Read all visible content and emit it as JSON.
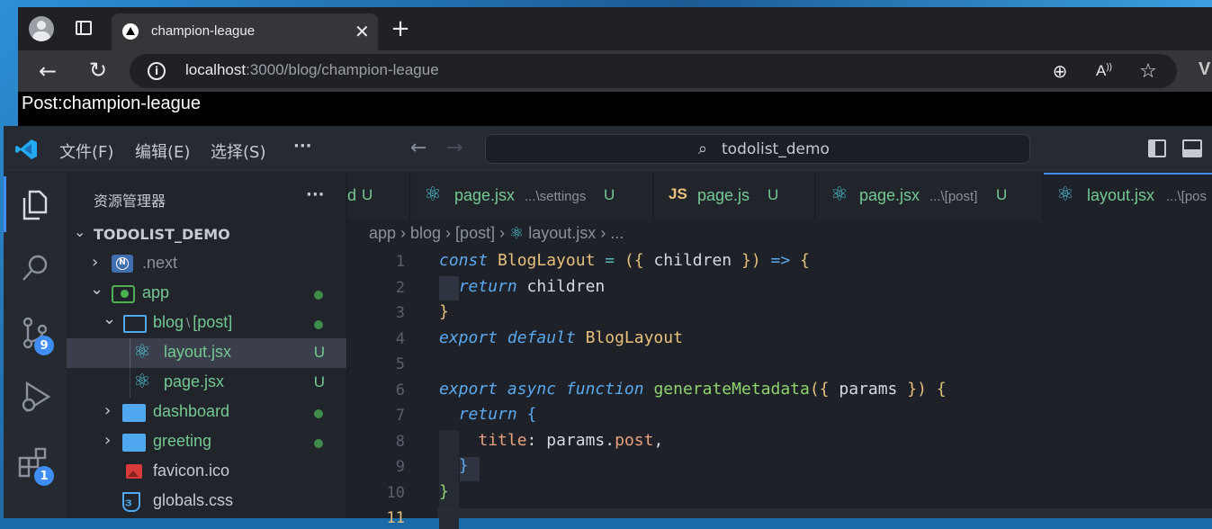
{
  "browser": {
    "tab_title": "champion-league",
    "url_host": "localhost",
    "url_rest": ":3000/blog/champion-league",
    "page_text": "Post:champion-league"
  },
  "vscode": {
    "menus": [
      "文件(F)",
      "编辑(E)",
      "选择(S)",
      "···"
    ],
    "search_text": "todolist_demo",
    "activity_badges": {
      "source_control": "9",
      "extensions": "1"
    },
    "explorer_title": "资源管理器",
    "explorer_more": "···",
    "workspace": "TODOLIST_DEMO",
    "tree": [
      {
        "label": ".next",
        "chevron": "›",
        "status": ""
      },
      {
        "label": "app",
        "chevron": "⌄",
        "status": "dot"
      },
      {
        "label": "blog",
        "sep": "\\",
        "sub": "[post]",
        "chevron": "⌄",
        "status": "dot"
      },
      {
        "label": "layout.jsx",
        "status": "U"
      },
      {
        "label": "page.jsx",
        "status": "U"
      },
      {
        "label": "dashboard",
        "chevron": "›",
        "status": "dot"
      },
      {
        "label": "greeting",
        "chevron": "›",
        "status": "dot"
      },
      {
        "label": "favicon.ico",
        "status": ""
      },
      {
        "label": "globals.css",
        "status": ""
      }
    ],
    "tabs": [
      {
        "label": "d",
        "u": "U"
      },
      {
        "label": "page.jsx",
        "desc": "...\\settings",
        "u": "U"
      },
      {
        "label": "page.js",
        "icon": "JS",
        "u": "U"
      },
      {
        "label": "page.jsx",
        "desc": "...\\[post]",
        "u": "U"
      },
      {
        "label": "layout.jsx",
        "desc": "...\\[pos"
      }
    ],
    "breadcrumb": "app › blog › [post] ›",
    "breadcrumb_file": "layout.jsx",
    "breadcrumb_tail": "› ...",
    "line_numbers": [
      "1",
      "2",
      "3",
      "4",
      "5",
      "6",
      "7",
      "8",
      "9",
      "10",
      "11"
    ],
    "code": {
      "l1_kw": "const",
      "l1_name": "BlogLayout",
      "l1_eq": " = ",
      "l1_paren": "({ ",
      "l1_param": "children",
      "l1_close": " })",
      "l1_arrow": " => ",
      "l1_brace": "{",
      "l2_kw": "return",
      "l2_val": " children",
      "l3": "}",
      "l4_kw1": "export",
      "l4_kw2": " default",
      "l4_name": " BlogLayout",
      "l6_kw1": "export",
      "l6_kw2": " async",
      "l6_kw3": " function",
      "l6_name": " generateMetadata",
      "l6_paren": "({ ",
      "l6_param": "params",
      "l6_close": " })",
      "l6_brace": " {",
      "l7_kw": "return",
      "l7_brace": " {",
      "l8_prop": "title",
      "l8_colon": ": ",
      "l8_obj": "params",
      "l8_dot": ".",
      "l8_field": "post",
      "l8_comma": ",",
      "l9": "}",
      "l10": "}"
    }
  }
}
